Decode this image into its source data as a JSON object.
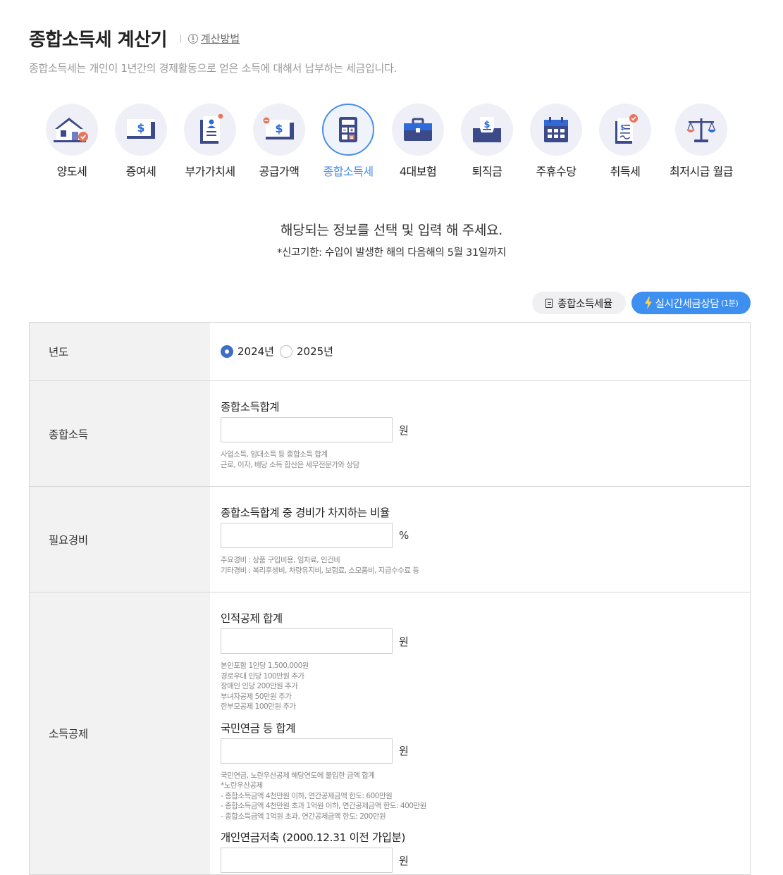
{
  "header": {
    "title": "종합소득세 계산기",
    "help_label": "계산방법",
    "subtitle": "종합소득세는 개인이 1년간의 경제활동으로 얻은 소득에 대해서 납부하는 세금입니다."
  },
  "calculators": [
    {
      "label": "양도세",
      "icon": "house-icon",
      "active": false
    },
    {
      "label": "증여세",
      "icon": "money-bill-icon",
      "active": false
    },
    {
      "label": "부가가치세",
      "icon": "document-person-icon",
      "active": false
    },
    {
      "label": "공급가액",
      "icon": "money-bill-minus-icon",
      "active": false
    },
    {
      "label": "종합소득세",
      "icon": "calculator-icon",
      "active": true
    },
    {
      "label": "4대보험",
      "icon": "briefcase-icon",
      "active": false
    },
    {
      "label": "퇴직금",
      "icon": "money-box-icon",
      "active": false
    },
    {
      "label": "주휴수당",
      "icon": "calendar-icon",
      "active": false
    },
    {
      "label": "취득세",
      "icon": "receipt-check-icon",
      "active": false
    },
    {
      "label": "최저시급 월급",
      "icon": "scale-icon",
      "active": false
    }
  ],
  "guide": {
    "title": "해당되는 정보를 선택 및 입력 해 주세요.",
    "deadline_note": "*신고기한: 수입이 발생한 해의 다음해의 5월 31일까지"
  },
  "actions": {
    "rate_label": "종합소득세율",
    "consult_label": "실시간세금상담",
    "consult_sub": "(1분)"
  },
  "colors": {
    "accent": "#4a8ee8",
    "consult_button": "#3d8ff0",
    "radio_checked": "#3e6ec8",
    "icon_navy": "#3c4a8a",
    "icon_badge": "#e8765f"
  },
  "form": {
    "year": {
      "label": "년도",
      "options": [
        {
          "label": "2024년",
          "checked": true
        },
        {
          "label": "2025년",
          "checked": false
        }
      ]
    },
    "income": {
      "label": "종합소득",
      "field_label": "종합소득합계",
      "value": "",
      "unit": "원",
      "help": [
        "사업소득, 임대소득 등 종합소득 합계",
        "근로, 이자, 배당 소득 합산은 세무전문가와 상담"
      ]
    },
    "expense": {
      "label": "필요경비",
      "field_label": "종합소득합계 중 경비가 차지하는 비율",
      "value": "",
      "unit": "%",
      "help": [
        "주요경비 : 상품 구입비용, 임차료, 인건비",
        "기타경비 : 복리후생비, 차량유지비, 보험료, 소모품비, 지급수수료 등"
      ]
    },
    "deduction": {
      "label": "소득공제",
      "fields": [
        {
          "label": "인적공제 합계",
          "value": "",
          "unit": "원",
          "help": [
            "본인포함 1인당 1,500,000원",
            "경로우대 인당 100만원 추가",
            "장애인 인당 200만원 추가",
            "부녀자공제 50만원 추가",
            "한부모공제 100만원 추가"
          ]
        },
        {
          "label": "국민연금 등 합계",
          "value": "",
          "unit": "원",
          "help": [
            "국민연금, 노란우산공제 해당연도에 불입한 금액 합계",
            "*노란우산공제",
            "- 종합소득금액 4천만원 이하, 연간공제금액 한도: 600만원",
            "- 종합소득금액 4천만원 초과 1억원 이하, 연간공제금액 한도: 400만원",
            "- 종합소득금액 1억원 초과, 연간공제금액 한도: 200만원"
          ]
        },
        {
          "label": "개인연금저축 (2000.12.31 이전 가입분)",
          "value": "",
          "unit": "원"
        }
      ]
    }
  }
}
